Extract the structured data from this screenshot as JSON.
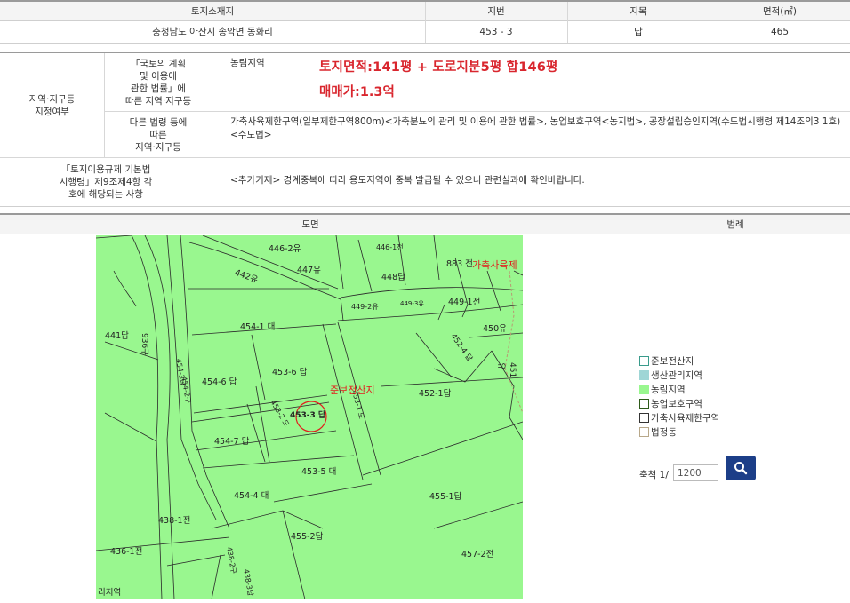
{
  "land_table": {
    "headers": [
      "토지소재지",
      "지번",
      "지목",
      "면적(㎡)"
    ],
    "location": "충청남도 아산시 송악면 동화리",
    "lot_number": "453 - 3",
    "land_category": "답",
    "area": "465"
  },
  "zoning": {
    "section_label": "지역·지구등\n지정여부",
    "row1_label": "「국토의 계획\n및 이용에\n관한 법률」에\n따른 지역·지구등",
    "row1_value": "농림지역",
    "note_area": "토지면적:141평 + 도로지분5평 합146평",
    "note_price": "매매가:1.3억",
    "row2_label": "다른 법령 등에\n따른\n지역·지구등",
    "row2_value": "가축사육제한구역(일부제한구역800m)<가축분뇨의 관리 및 이용에 관한 법률>, 농업보호구역<농지법>, 공장설립승인지역(수도법시행령 제14조의3 1호)<수도법>",
    "row3_label": "「토지이용규제 기본법\n시행령」제9조제4항 각\n호에 해당되는 사항",
    "row3_value": "<추가기재> 경계중복에 따라 용도지역이 중복 발급될 수 있으니 관련실과에 확인바랍니다."
  },
  "map_section": {
    "map_header": "도면",
    "legend_header": "범례",
    "parcels": [
      "446-2유",
      "446-1전",
      "883 전",
      "447유",
      "442유",
      "448답",
      "449-2유",
      "449-3유",
      "449-1전",
      "454-1 대",
      "450유",
      "441답",
      "936구",
      "452-4 답",
      "453-6 답",
      "454-6 답",
      "451유",
      "452-1답",
      "454-7 답",
      "453-5 대",
      "454-4 대",
      "455-1답",
      "438-1전",
      "455-2답",
      "436-1전",
      "457-2전",
      "453-3 답",
      "453-2 도",
      "453-1 도",
      "454-2구",
      "454-3답",
      "438-2구",
      "438-3답"
    ],
    "map_labels": {
      "livestock": "가축사육제",
      "reserve": "준보전산지",
      "agri": "리지역"
    },
    "legend": [
      {
        "label": "준보전산지",
        "color": "#ffffff",
        "border": "#3a9b8c"
      },
      {
        "label": "생산관리지역",
        "color": "#9fd6d6",
        "border": "#9fd6d6"
      },
      {
        "label": "농림지역",
        "color": "#99f78f",
        "border": "#99f78f"
      },
      {
        "label": "농업보호구역",
        "color": "#ffffff",
        "border": "#2e5b1a"
      },
      {
        "label": "가축사육제한구역",
        "color": "#ffffff",
        "border": "#333333"
      },
      {
        "label": "법정동",
        "color": "#ffffff",
        "border": "#b8a88a"
      }
    ],
    "scale_label": "축척 1/",
    "scale_value": "1200",
    "search_icon": "search-icon"
  }
}
